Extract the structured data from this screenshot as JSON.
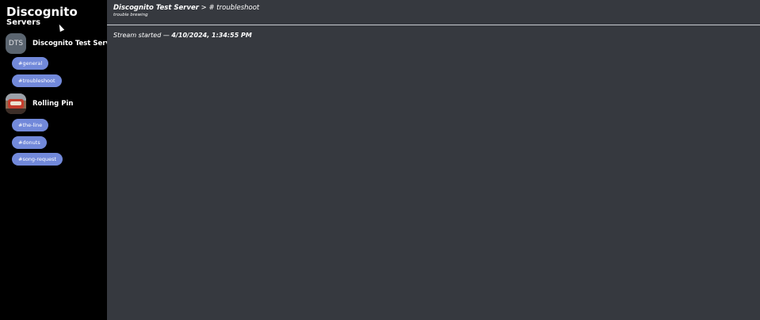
{
  "sidebar": {
    "app_title": "Discognito",
    "servers_heading": "Servers",
    "servers": [
      {
        "name": "Discognito Test Server",
        "avatar_initials": "DTS",
        "channels": [
          "#general",
          "#troubleshoot"
        ]
      },
      {
        "name": "Rolling Pin",
        "avatar_icon": "server-image-icon",
        "channels": [
          "#the-line",
          "#donuts",
          "#song-request"
        ]
      }
    ]
  },
  "header": {
    "server_name": "Discognito Test Server",
    "separator": ">",
    "channel_name": "# troubleshoot",
    "topic": "trouble brewing"
  },
  "stream": {
    "prefix": "Stream started —",
    "timestamp": "4/10/2024, 1:34:55 PM"
  },
  "colors": {
    "sidebar_bg": "#000000",
    "main_bg": "#36393f",
    "channel_pill": "#7289da",
    "text": "#ffffff"
  }
}
